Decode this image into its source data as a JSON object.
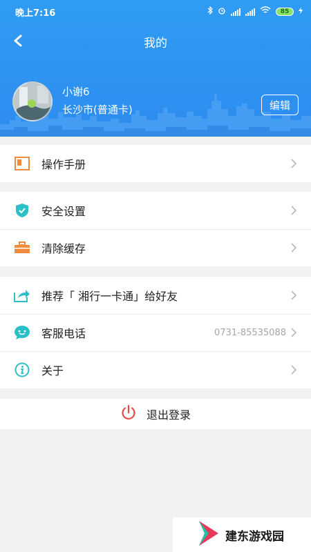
{
  "status_bar": {
    "time": "晚上7:16",
    "battery": "85"
  },
  "header": {
    "title": "我的"
  },
  "profile": {
    "name": "小谢6",
    "city_card": "长沙市(普通卡)",
    "edit_label": "编辑"
  },
  "menu": {
    "manual": {
      "label": "操作手册",
      "icon": "manual-icon"
    },
    "security": {
      "label": "安全设置",
      "icon": "shield-icon"
    },
    "clear_cache": {
      "label": "清除缓存",
      "icon": "briefcase-icon"
    },
    "recommend": {
      "label": "推荐「 湘行一卡通」给好友",
      "icon": "share-icon"
    },
    "service": {
      "label": "客服电话",
      "value": "0731-85535088",
      "icon": "chat-icon"
    },
    "about": {
      "label": "关于",
      "icon": "info-icon"
    }
  },
  "logout": {
    "label": "退出登录",
    "icon": "power-icon"
  },
  "watermark": {
    "text": "建东游戏园"
  },
  "colors": {
    "header_blue": "#2d8cf0",
    "manual_orange": "#f08a3c",
    "teal": "#2bbfc7",
    "logout_red": "#e84a4a"
  }
}
